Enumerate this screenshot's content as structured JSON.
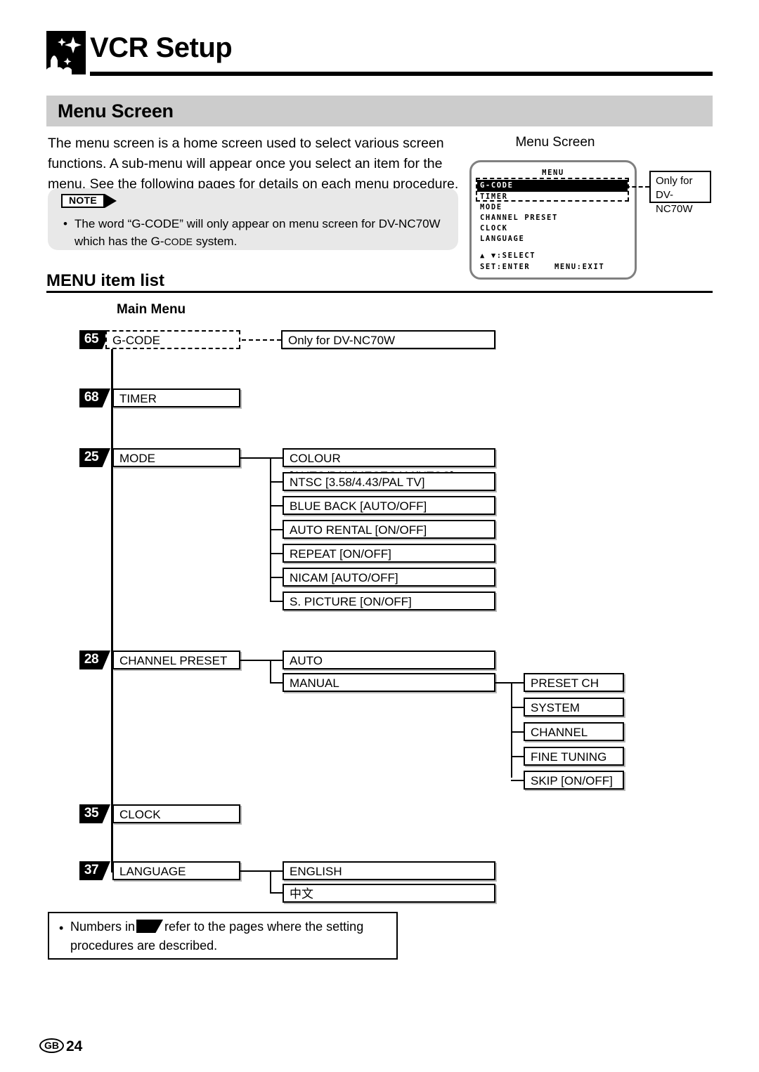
{
  "header": {
    "chapter_title": "VCR Setup",
    "icon": "sparkle-icon"
  },
  "section": {
    "title": "Menu Screen"
  },
  "intro": {
    "paragraph": "The menu screen is a home screen used to select various screen functions. A sub-menu will appear once you select an item for the menu. See the following pages for details on each menu procedure."
  },
  "note": {
    "badge_label": "NOTE",
    "bullet_part1": "The word “G-CODE” will only appear on menu screen for DV-NC70W which has the G-",
    "bullet_smallcaps": "CODE",
    "bullet_part2": " system."
  },
  "tv_figure": {
    "caption": "Menu Screen",
    "osd": {
      "title": "MENU",
      "highlighted_item": "G-CODE",
      "items": [
        "TIMER",
        "MODE",
        "CHANNEL PRESET",
        "CLOCK",
        "LANGUAGE"
      ],
      "footer_select": "▲ ▼:SELECT",
      "footer_enter": "SET:ENTER",
      "footer_exit": "MENU:EXIT"
    },
    "callout_line1": "Only for",
    "callout_line2": "DV-NC70W"
  },
  "menu_list": {
    "heading": "MENU item list",
    "main_menu_label": "Main Menu",
    "main_items": [
      {
        "page": "65",
        "label": "G-CODE",
        "note": "Only for DV-NC70W"
      },
      {
        "page": "68",
        "label": "TIMER"
      },
      {
        "page": "25",
        "label": "MODE"
      },
      {
        "page": "28",
        "label": "CHANNEL PRESET"
      },
      {
        "page": "35",
        "label": "CLOCK"
      },
      {
        "page": "37",
        "label": "LANGUAGE"
      }
    ],
    "mode_sub": [
      "COLOUR [AUTO/PAL/MESECAM/NTSC]",
      "NTSC [3.58/4.43/PAL TV]",
      "BLUE BACK [AUTO/OFF]",
      "AUTO RENTAL [ON/OFF]",
      "REPEAT [ON/OFF]",
      "NICAM [AUTO/OFF]",
      "S. PICTURE [ON/OFF]"
    ],
    "channel_preset_sub": [
      "AUTO",
      "MANUAL"
    ],
    "manual_sub": [
      "PRESET CH",
      "SYSTEM",
      "CHANNEL",
      "FINE TUNING",
      "SKIP [ON/OFF]"
    ],
    "language_sub": [
      "ENGLISH",
      "中文"
    ]
  },
  "bottom_note": {
    "text_before": "Numbers in",
    "text_after": "refer to the pages where the setting procedures are described."
  },
  "footer": {
    "region": "GB",
    "page_number": "24"
  }
}
